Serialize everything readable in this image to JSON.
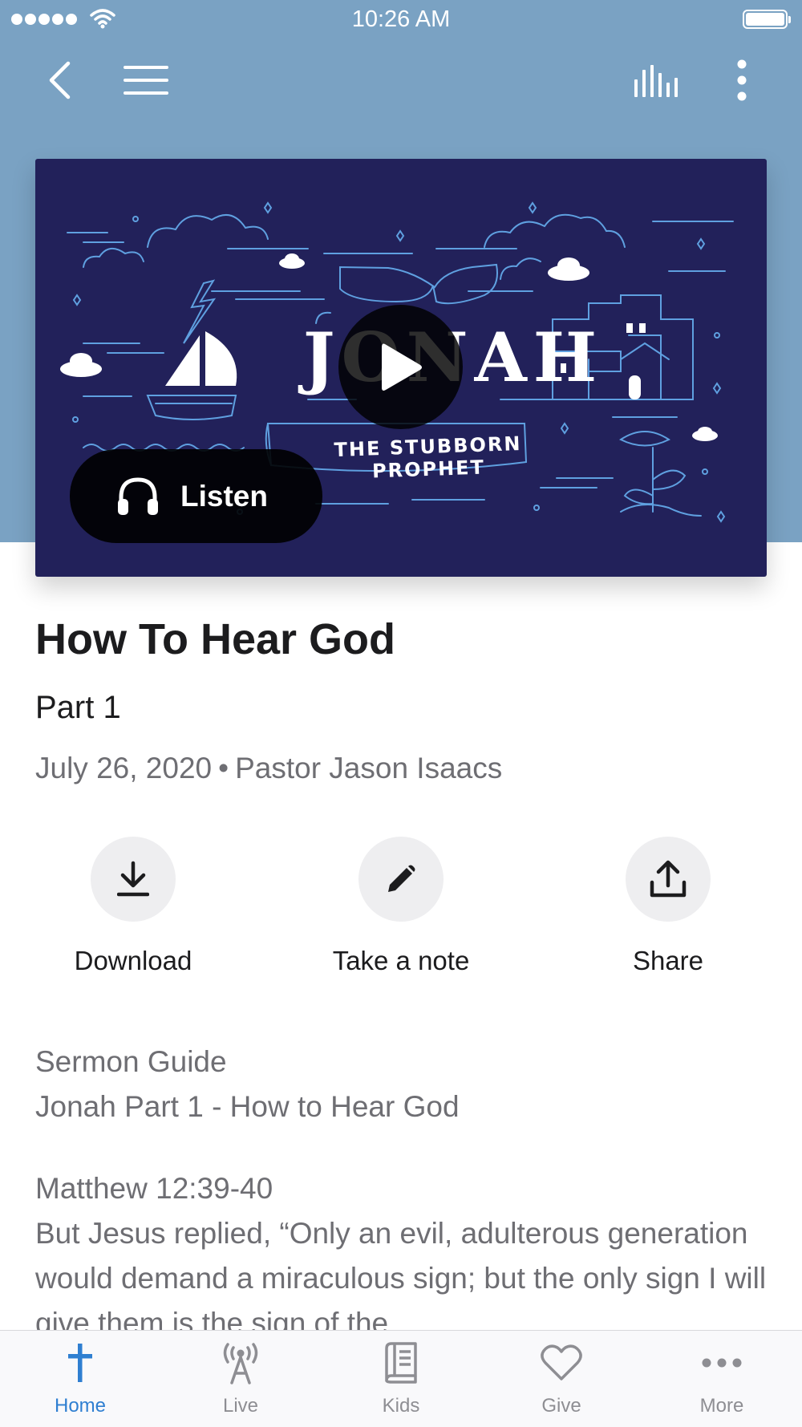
{
  "status_bar": {
    "time": "10:26 AM"
  },
  "nav": {
    "back_icon": "chevron-left-icon",
    "menu_icon": "hamburger-menu-icon",
    "audio_icon": "audio-bars-icon",
    "more_icon": "vertical-dots-icon"
  },
  "artwork": {
    "title": "JONAH",
    "banner": "THE STUBBORN PROPHET",
    "play_icon": "play-icon",
    "listen_label": "Listen",
    "listen_icon": "headphones-icon"
  },
  "sermon": {
    "title": "How To Hear God",
    "part": "Part 1",
    "date": "July 26, 2020",
    "separator": "•",
    "speaker": "Pastor Jason Isaacs"
  },
  "actions": [
    {
      "label": "Download",
      "icon": "download-icon"
    },
    {
      "label": "Take a note",
      "icon": "pencil-icon"
    },
    {
      "label": "Share",
      "icon": "share-icon"
    }
  ],
  "guide": {
    "heading": "Sermon Guide",
    "subheading": "Jonah Part 1 - How to Hear God",
    "reference": "Matthew 12:39-40",
    "text": "But Jesus replied, “Only an evil, adulterous generation would demand a miraculous sign; but the only sign I will give them is the sign of the"
  },
  "tab_bar": {
    "active": "Home",
    "tabs": [
      {
        "label": "Home",
        "icon": "cross-icon"
      },
      {
        "label": "Live",
        "icon": "broadcast-icon"
      },
      {
        "label": "Kids",
        "icon": "book-icon"
      },
      {
        "label": "Give",
        "icon": "heart-icon"
      },
      {
        "label": "More",
        "icon": "horizontal-dots-icon"
      }
    ]
  },
  "colors": {
    "header_background": "#7aa2c3",
    "artwork_background": "#22215a",
    "artwork_line": "#5fa0e0",
    "accent": "#2f7fd1",
    "secondary_text": "#6e6e73"
  }
}
